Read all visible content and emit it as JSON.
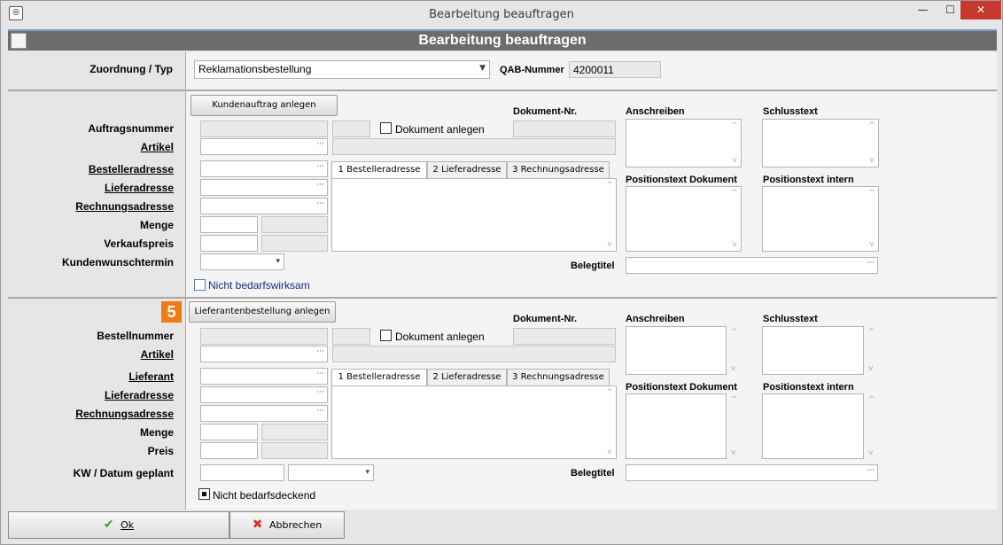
{
  "window": {
    "title": "Bearbeitung beauftragen",
    "minimize": "—",
    "maximize": "☐",
    "close": "✕"
  },
  "header": {
    "title": "Bearbeitung beauftragen"
  },
  "top": {
    "zuordnung_label": "Zuordnung / Typ",
    "zuordnung_value": "Reklamationsbestellung",
    "qab_label": "QAB-Nummer",
    "qab_value": "4200011"
  },
  "kunde": {
    "button": "Kundenauftrag anlegen",
    "auftragsnummer": "Auftragsnummer",
    "artikel": "Artikel",
    "besteller": "Bestelleradresse",
    "liefer": "Lieferadresse",
    "rechnung": "Rechnungsadresse",
    "menge": "Menge",
    "preis": "Verkaufspreis",
    "termin": "Kundenwunschtermin",
    "dok_anlegen": "Dokument anlegen",
    "doknr": "Dokument-Nr.",
    "anschreiben": "Anschreiben",
    "schluss": "Schlusstext",
    "postext": "Positionstext Dokument",
    "posintern": "Positionstext intern",
    "belegtitel": "Belegtitel",
    "checkbox": "Nicht bedarfswirksam",
    "tabs": [
      "1 Bestelleradresse",
      "2 Lieferadresse",
      "3 Rechnungsadresse"
    ]
  },
  "liefer": {
    "badge": "5",
    "button": "Lieferantenbestellung anlegen",
    "bestellnummer": "Bestellnummer",
    "artikel": "Artikel",
    "lieferant": "Lieferant",
    "liefer": "Lieferadresse",
    "rechnung": "Rechnungsadresse",
    "menge": "Menge",
    "preis": "Preis",
    "kw": "KW / Datum geplant",
    "dok_anlegen": "Dokument anlegen",
    "doknr": "Dokument-Nr.",
    "anschreiben": "Anschreiben",
    "schluss": "Schlusstext",
    "postext": "Positionstext Dokument",
    "posintern": "Positionstext intern",
    "belegtitel": "Belegtitel",
    "checkbox": "Nicht bedarfsdeckend",
    "tabs": [
      "1 Bestelleradresse",
      "2 Lieferadresse",
      "3 Rechnungsadresse"
    ]
  },
  "footer": {
    "ok": "Ok",
    "cancel": "Abbrechen"
  },
  "colors": {
    "accent": "#f07b16",
    "header": "#6c6c6c",
    "ok_icon": "#3a9a3a",
    "cancel_icon": "#d23a2a"
  }
}
